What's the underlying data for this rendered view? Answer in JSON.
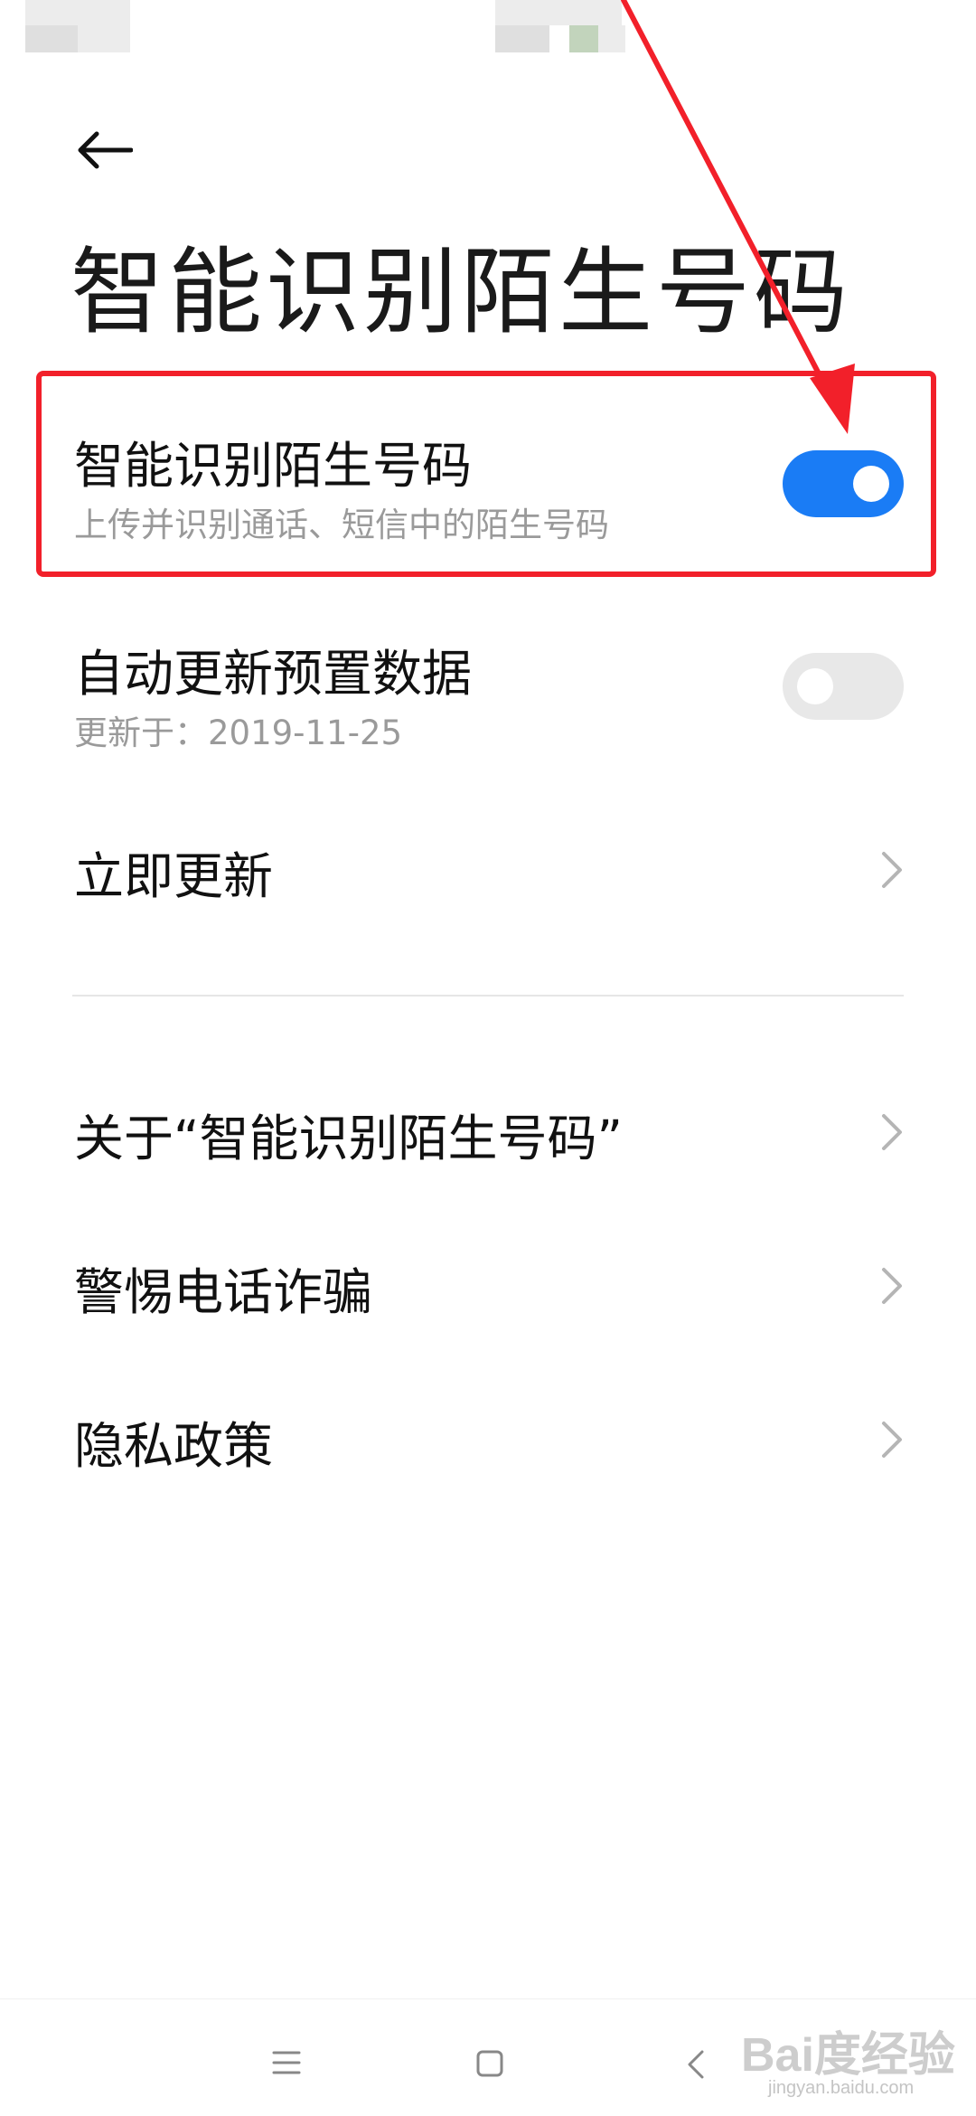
{
  "header": {
    "title": "智能识别陌生号码"
  },
  "settings": {
    "smart_identify": {
      "title": "智能识别陌生号码",
      "subtitle": "上传并识别通话、短信中的陌生号码",
      "enabled": true
    },
    "auto_update": {
      "title": "自动更新预置数据",
      "subtitle": "更新于：2019-11-25",
      "enabled": false
    },
    "update_now": {
      "title": "立即更新"
    },
    "about": {
      "title": "关于“智能识别陌生号码”"
    },
    "fraud_alert": {
      "title": "警惕电话诈骗"
    },
    "privacy": {
      "title": "隐私政策"
    }
  },
  "colors": {
    "toggle_on": "#1a7cf5",
    "toggle_off": "#e8e8e8",
    "annotation": "#f2202a"
  },
  "icons": {
    "back": "arrow-left",
    "chevron": "chevron-right",
    "nav_menu": "menu",
    "nav_home": "square",
    "nav_back": "chevron-left"
  },
  "watermark": {
    "brand": "Bai度经验",
    "url": "jingyan.baidu.com"
  }
}
